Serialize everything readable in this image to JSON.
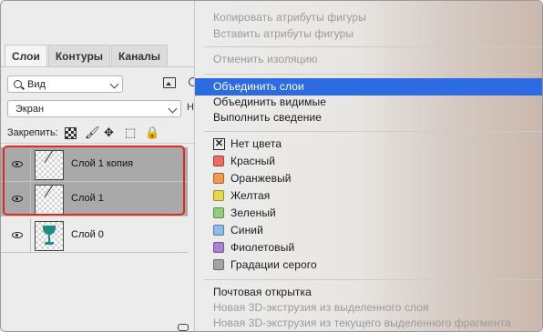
{
  "tabs": [
    {
      "label": "Слои",
      "active": true
    },
    {
      "label": "Контуры",
      "active": false
    },
    {
      "label": "Каналы",
      "active": false
    }
  ],
  "filter": {
    "kind_label": "Вид"
  },
  "blend_mode": {
    "value": "Экран"
  },
  "lock": {
    "label": "Закрепить:"
  },
  "layers": [
    {
      "name": "Слой 1 копия",
      "selected": true,
      "visible": true
    },
    {
      "name": "Слой 1",
      "selected": true,
      "visible": true
    },
    {
      "name": "Слой 0",
      "selected": false,
      "visible": true
    }
  ],
  "menu": {
    "group1": [
      "Копировать атрибуты фигуры",
      "Вставить атрибуты фигуры"
    ],
    "group2": [
      "Отменить изоляцию"
    ],
    "group3": [
      "Объединить слои",
      "Объединить видимые",
      "Выполнить сведение"
    ],
    "colors": [
      {
        "label": "Нет цвета",
        "color": null
      },
      {
        "label": "Красный",
        "color": "#ee6a64"
      },
      {
        "label": "Оранжевый",
        "color": "#f19a4c"
      },
      {
        "label": "Желтая",
        "color": "#e8d84a"
      },
      {
        "label": "Зеленый",
        "color": "#8fd17b"
      },
      {
        "label": "Синий",
        "color": "#8bbcec"
      },
      {
        "label": "Фиолетовый",
        "color": "#a783d4"
      },
      {
        "label": "Градации серого",
        "color": "#a3a3a3"
      }
    ],
    "group5": [
      "Почтовая открытка",
      "Новая 3D-экструзия из выделенного слоя",
      "Новая 3D-экструзия из текущего выделенного фрагмента"
    ],
    "highlighted": "Объединить слои"
  },
  "accent_colors": {
    "selection": "#2d6be3",
    "annotation": "#e0281e"
  }
}
